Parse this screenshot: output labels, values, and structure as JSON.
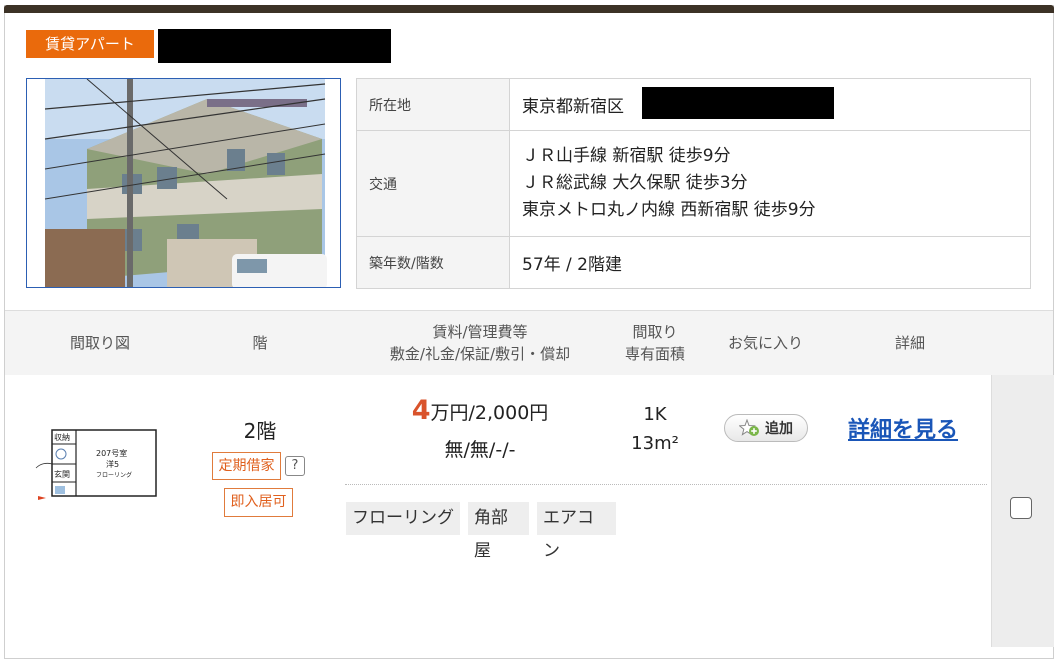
{
  "listing": {
    "type_badge": "賃貸アパート",
    "info": {
      "address_label": "所在地",
      "address_value": "東京都新宿区",
      "transit_label": "交通",
      "transit_lines": [
        "ＪＲ山手線 新宿駅 徒歩9分",
        "ＪＲ総武線 大久保駅 徒歩3分",
        "東京メトロ丸ノ内線 西新宿駅 徒歩9分"
      ],
      "age_label": "築年数/階数",
      "age_value": "57年 / 2階建"
    }
  },
  "table_header": {
    "floorplan": "間取り図",
    "floor": "階",
    "rent_line1": "賃料/管理費等",
    "rent_line2": "敷金/礼金/保証/敷引・償却",
    "layout_line1": "間取り",
    "layout_line2": "専有面積",
    "favorite": "お気に入り",
    "detail": "詳細"
  },
  "room": {
    "floor": "2階",
    "tags": [
      "定期借家",
      "即入居可"
    ],
    "help": "?",
    "rent_big": "4",
    "rent_rest": "万円/2,000円",
    "deposit": "無/無/-/-",
    "layout": "1K",
    "area": "13m²",
    "fav_button": "追加",
    "detail_link": "詳細を見る",
    "features": [
      "フローリング",
      "角部屋",
      "エアコン"
    ],
    "floorplan_labels": {
      "storage": "収納",
      "entrance": "玄関",
      "room": "207号室",
      "room_type": "洋5",
      "flooring": "フローリング"
    }
  }
}
